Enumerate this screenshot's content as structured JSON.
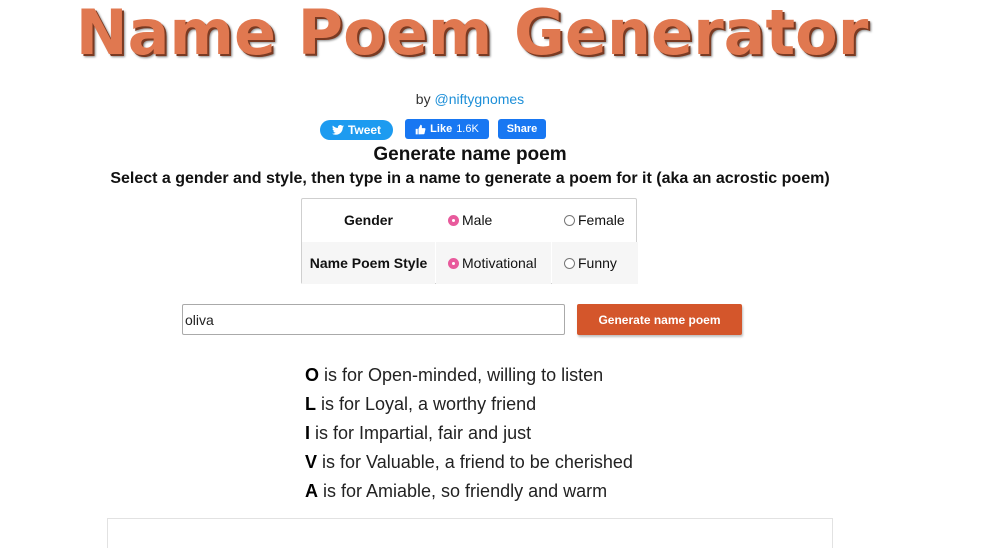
{
  "header": {
    "title": "Name Poem Generator",
    "byline_prefix": "by",
    "byline_link": "@niftygnomes"
  },
  "social": {
    "tweet_label": "Tweet",
    "like_label": "Like",
    "like_count": "1.6K",
    "share_label": "Share",
    "colors": {
      "twitter": "#1d9bf0",
      "facebook": "#1877f2"
    }
  },
  "form": {
    "heading": "Generate name poem",
    "instructions": "Select a gender and style, then type in a name to generate a poem for it (aka an acrostic poem)",
    "gender": {
      "label": "Gender",
      "options": [
        "Male",
        "Female"
      ],
      "selected": "Male"
    },
    "style": {
      "label": "Name Poem Style",
      "options": [
        "Motivational",
        "Funny"
      ],
      "selected": "Motivational"
    },
    "name_value": "oliva",
    "button_label": "Generate name poem",
    "accent_color": "#d4562b",
    "radio_checked_color": "#e85a9c"
  },
  "poem": {
    "lines": [
      {
        "letter": "O",
        "text": " is for Open-minded, willing to listen"
      },
      {
        "letter": "L",
        "text": " is for Loyal, a worthy friend"
      },
      {
        "letter": "I",
        "text": " is for Impartial, fair and just"
      },
      {
        "letter": "V",
        "text": " is for Valuable, a friend to be cherished"
      },
      {
        "letter": "A",
        "text": " is for Amiable, so friendly and warm"
      }
    ]
  }
}
